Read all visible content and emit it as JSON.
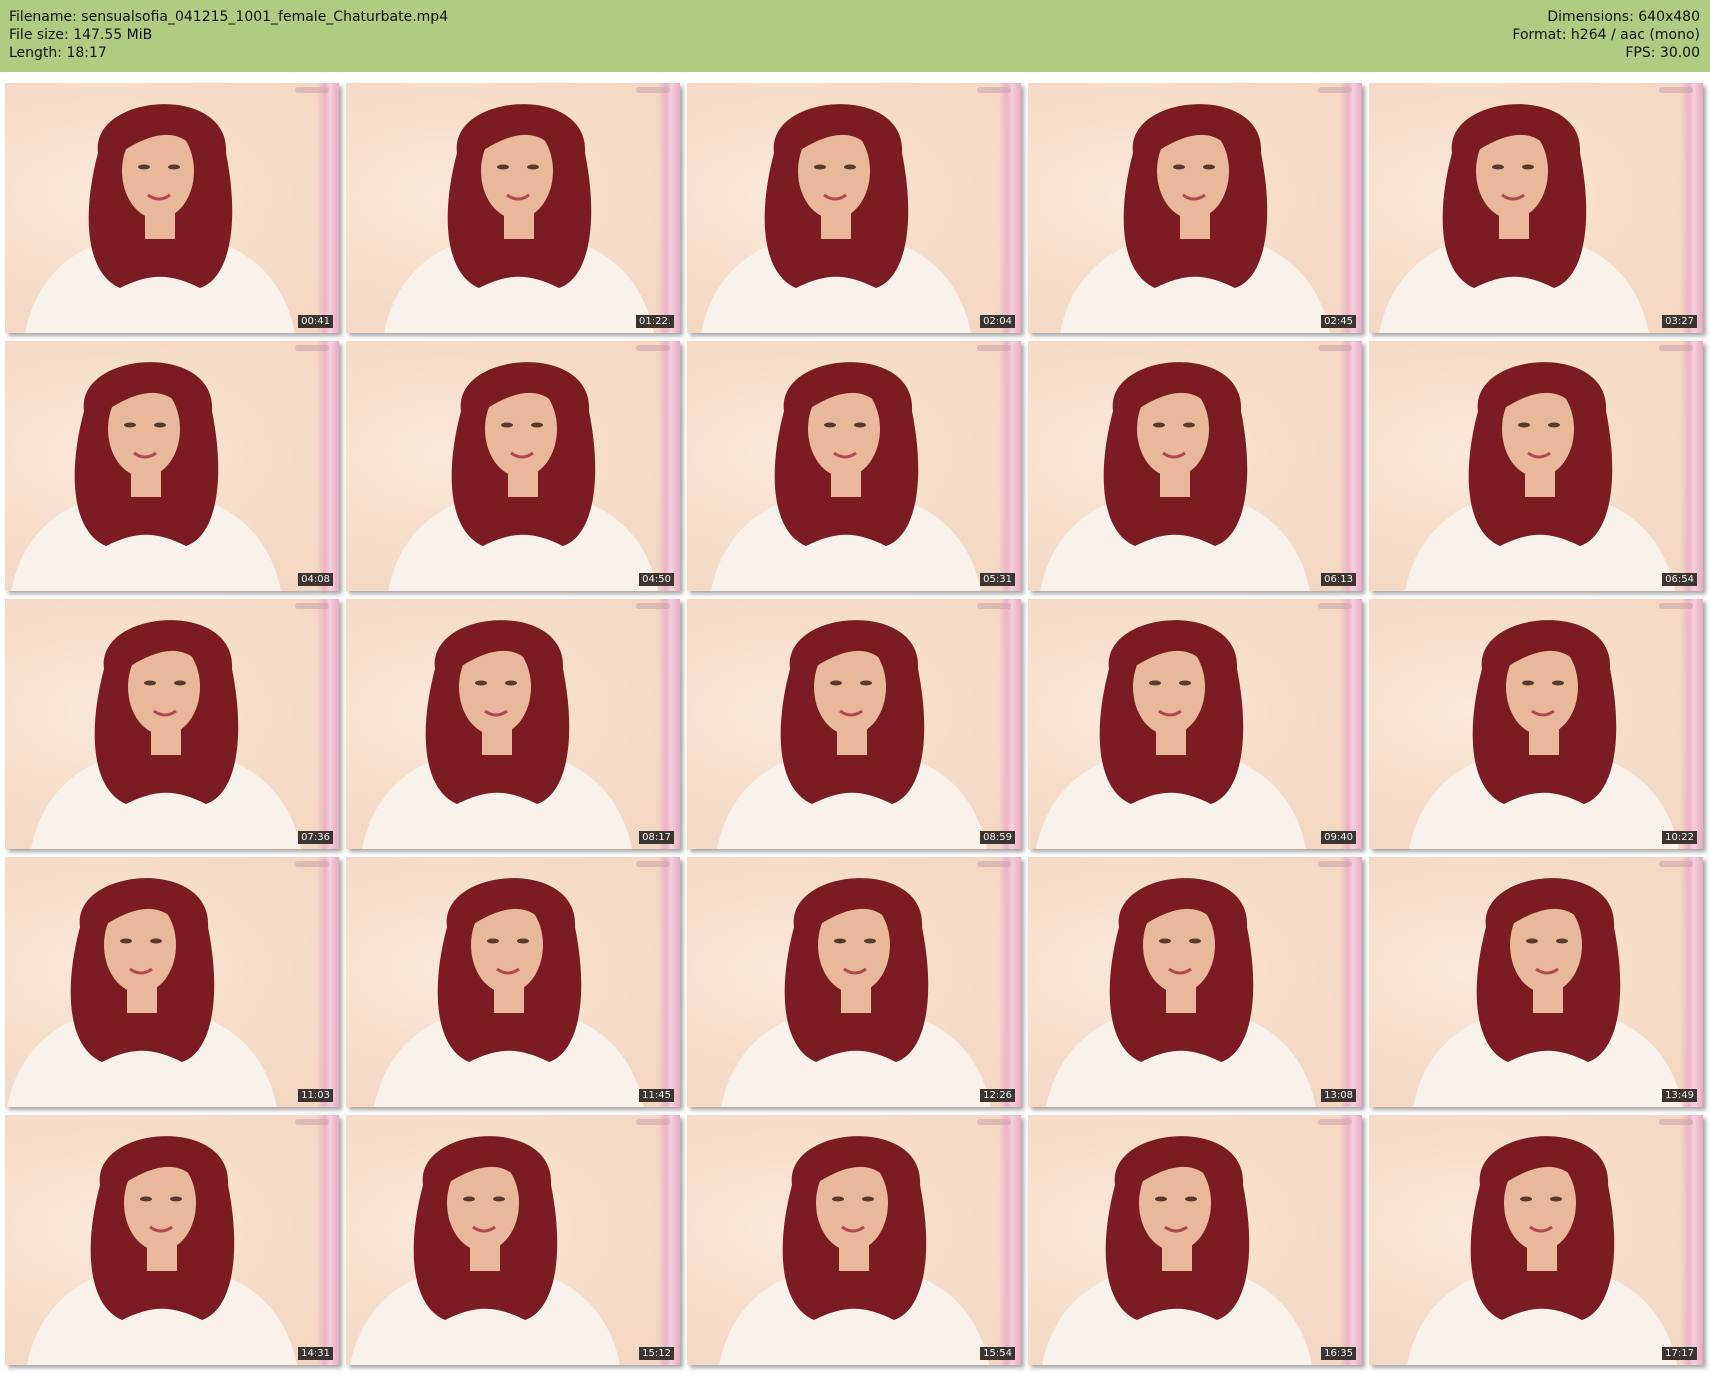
{
  "header": {
    "filename": "Filename: sensualsofia_041215_1001_female_Chaturbate.mp4",
    "filesize": "File size: 147.55 MiB",
    "length": "Length: 18:17",
    "dimensions": "Dimensions: 640x480",
    "format": "Format: h264 / aac (mono)",
    "fps": "FPS: 30.00"
  },
  "colors": {
    "header_bg": "#aecd82",
    "hair": "#7a1c22",
    "shirt": "#f8f2ea",
    "skin": "#e9b89a"
  },
  "thumbnails": [
    {
      "time": "00:41"
    },
    {
      "time": "01:22."
    },
    {
      "time": "02:04"
    },
    {
      "time": "02:45"
    },
    {
      "time": "03:27"
    },
    {
      "time": "04:08"
    },
    {
      "time": "04:50"
    },
    {
      "time": "05:31"
    },
    {
      "time": "06:13"
    },
    {
      "time": "06:54"
    },
    {
      "time": "07:36"
    },
    {
      "time": "08:17"
    },
    {
      "time": "08:59"
    },
    {
      "time": "09:40"
    },
    {
      "time": "10:22"
    },
    {
      "time": "11:03"
    },
    {
      "time": "11:45"
    },
    {
      "time": "12:26"
    },
    {
      "time": "13:08"
    },
    {
      "time": "13:49"
    },
    {
      "time": "14:31"
    },
    {
      "time": "15:12"
    },
    {
      "time": "15:54"
    },
    {
      "time": "16:35"
    },
    {
      "time": "17:17"
    }
  ]
}
